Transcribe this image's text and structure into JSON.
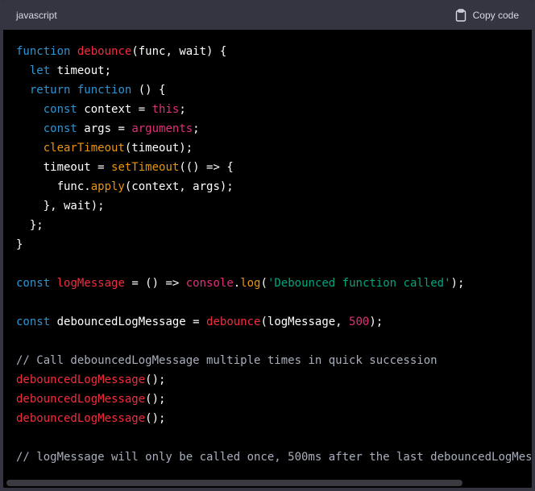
{
  "header": {
    "language": "javascript",
    "copy_label": "Copy code",
    "copy_icon": "clipboard-icon"
  },
  "code": {
    "l1": [
      "function",
      " ",
      "debounce",
      "(func, wait) {"
    ],
    "l2": [
      "  ",
      "let",
      " timeout;"
    ],
    "l3": [
      "  ",
      "return",
      " ",
      "function",
      " () {"
    ],
    "l4": [
      "    ",
      "const",
      " context = ",
      "this",
      ";"
    ],
    "l5": [
      "    ",
      "const",
      " args = ",
      "arguments",
      ";"
    ],
    "l6": [
      "    ",
      "clearTimeout",
      "(timeout);"
    ],
    "l7": [
      "    timeout = ",
      "setTimeout",
      "(() => {"
    ],
    "l8": [
      "      func.",
      "apply",
      "(context, args);"
    ],
    "l9": "    }, wait);",
    "l10": "  };",
    "l11": "}",
    "l13": [
      "const",
      " ",
      "logMessage",
      " = () => ",
      "console",
      ".",
      "log",
      "(",
      "'Debounced function called'",
      ");"
    ],
    "l15": [
      "const",
      " debouncedLogMessage = ",
      "debounce",
      "(logMessage, ",
      "500",
      ");"
    ],
    "l17": "// Call debouncedLogMessage multiple times in quick succession",
    "l18": [
      "debouncedLogMessage",
      "();"
    ],
    "l19": [
      "debouncedLogMessage",
      "();"
    ],
    "l20": [
      "debouncedLogMessage",
      "();"
    ],
    "l22": "// logMessage will only be called once, 500ms after the last debouncedLogMes"
  }
}
